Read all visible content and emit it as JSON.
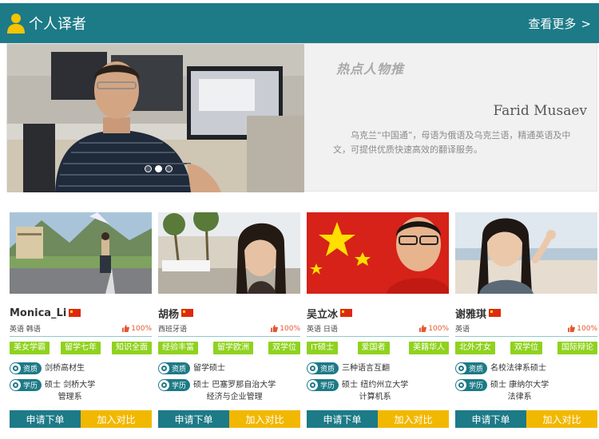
{
  "header": {
    "title": "个人译者",
    "more_label": "查看更多",
    "more_chevron": ">"
  },
  "banner": {
    "tag": "热点人物推",
    "name": "Farid Musaev",
    "description": "乌克兰“中国通”，母语为俄语及乌克兰语，精通英语及中文，可提供优质快速高效的翻译服务。",
    "active_slide_index": 1,
    "slide_count": 3
  },
  "labels": {
    "resource": "资质",
    "education": "学历",
    "apply": "申请下单",
    "compare": "加入对比"
  },
  "translators": [
    {
      "name": "Monica_Li",
      "languages": "英语 韩语",
      "rating": "100%",
      "tags": [
        "美女学霸",
        "留学七年",
        "知识全面"
      ],
      "resource": "剑桥高材生",
      "education_line1": "硕士 剑桥大学",
      "education_line2": "管理系"
    },
    {
      "name": "胡杨",
      "languages": "西班牙语",
      "rating": "100%",
      "tags": [
        "经验丰富",
        "留学欧洲",
        "双学位"
      ],
      "resource": "留学硕士",
      "education_line1": "硕士 巴塞罗那自治大学",
      "education_line2": "经济与企业管理"
    },
    {
      "name": "吴立冰",
      "languages": "英语 日语",
      "rating": "100%",
      "tags": [
        "IT硕士",
        "爱国者",
        "美籍华人"
      ],
      "resource": "三种语言互翻",
      "education_line1": "硕士 纽约州立大学",
      "education_line2": "计算机系"
    },
    {
      "name": "谢雅琪",
      "languages": "英语",
      "rating": "100%",
      "tags": [
        "北外才女",
        "双学位",
        "国际辩论"
      ],
      "resource": "名校法律系硕士",
      "education_line1": "硕士 康纳尔大学",
      "education_line2": "法律系"
    }
  ],
  "colors": {
    "primary": "#1d7a87",
    "tag_green": "#8fd21f",
    "compare_yellow": "#f2b800",
    "rating_orange": "#e4572e"
  }
}
